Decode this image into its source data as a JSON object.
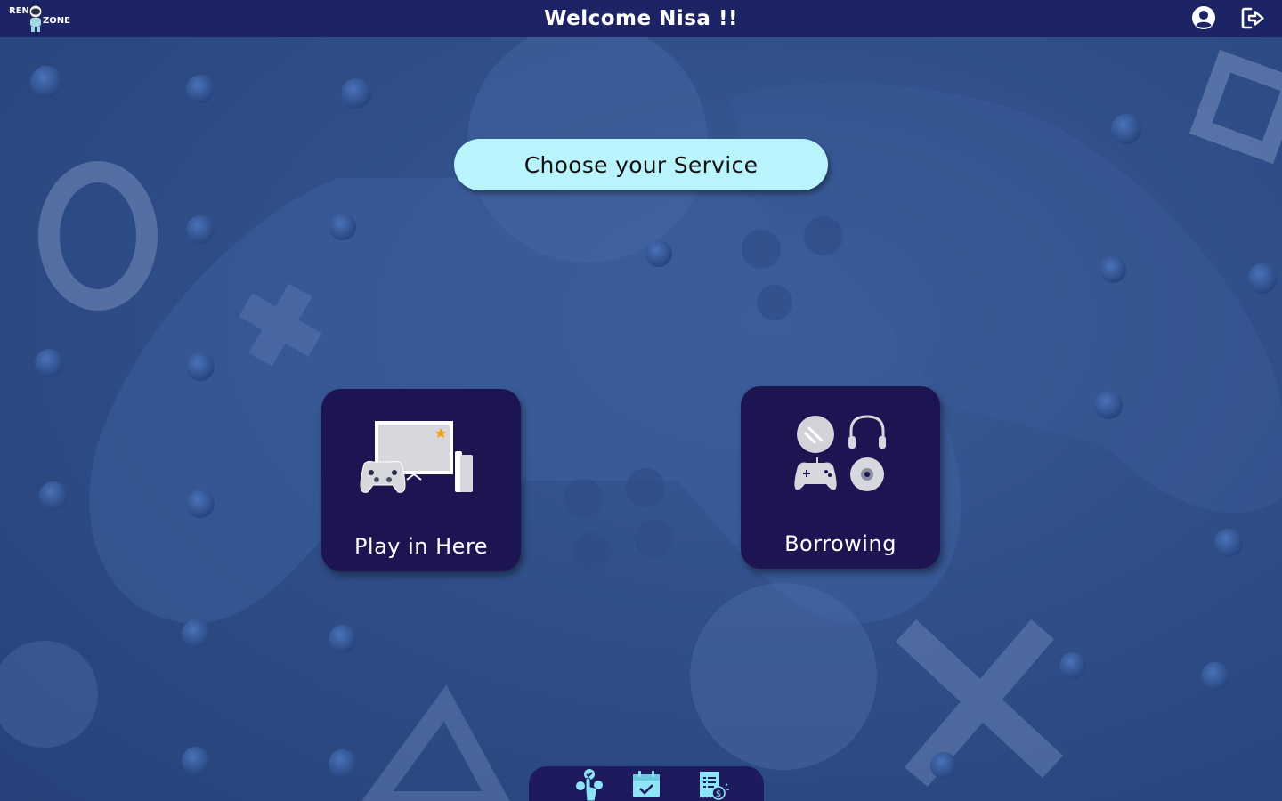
{
  "app": {
    "logo_text_top": "REN",
    "logo_text_bottom": "ZONE"
  },
  "header": {
    "welcome_text": "Welcome Nisa !!",
    "user_icon": "user-circle-icon",
    "logout_icon": "logout-icon"
  },
  "main": {
    "choose_label": "Choose your Service",
    "services": [
      {
        "label": "Play in Here",
        "icon": "tv-console-controller-icon"
      },
      {
        "label": "Borrowing",
        "icon": "rental-equipment-icon"
      }
    ]
  },
  "bottom_nav": {
    "items": [
      {
        "icon": "select-service-icon"
      },
      {
        "icon": "calendar-check-icon"
      },
      {
        "icon": "bill-receipt-icon"
      }
    ]
  },
  "colors": {
    "topbar": "#1d2466",
    "background": "#2f4f8a",
    "choose_button": "#b9f3fb",
    "card": "#1c1551",
    "bottom_nav": "#1d1b5e",
    "accent_icon": "#8fe3f7"
  }
}
